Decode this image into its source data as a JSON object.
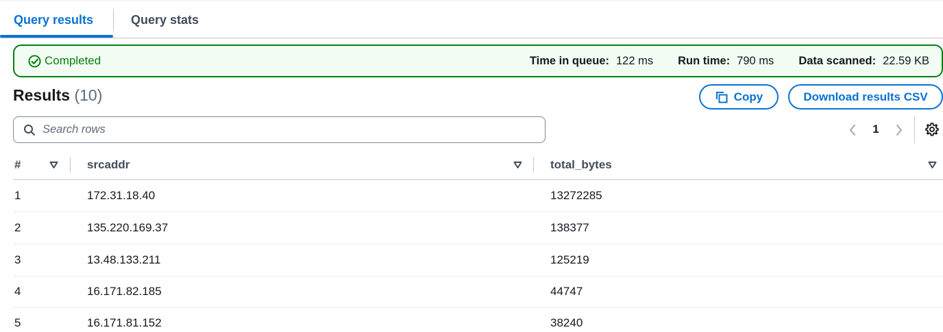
{
  "tabs": [
    {
      "label": "Query results",
      "active": true
    },
    {
      "label": "Query stats",
      "active": false
    }
  ],
  "status": {
    "text": "Completed",
    "color": "#037f0c",
    "icon": "check-circle-icon",
    "stats": [
      {
        "label": "Time in queue:",
        "value": "122 ms"
      },
      {
        "label": "Run time:",
        "value": "790 ms"
      },
      {
        "label": "Data scanned:",
        "value": "22.59 KB"
      }
    ]
  },
  "results": {
    "title": "Results",
    "count": "(10)",
    "copy_label": "Copy",
    "download_label": "Download results CSV"
  },
  "search": {
    "placeholder": "Search rows",
    "value": ""
  },
  "pagination": {
    "current_page": "1"
  },
  "table": {
    "columns": [
      "#",
      "srcaddr",
      "total_bytes"
    ],
    "rows": [
      [
        "1",
        "172.31.18.40",
        "13272285"
      ],
      [
        "2",
        "135.220.169.37",
        "138377"
      ],
      [
        "3",
        "13.48.133.211",
        "125219"
      ],
      [
        "4",
        "16.171.82.185",
        "44747"
      ],
      [
        "5",
        "16.171.81.152",
        "38240"
      ]
    ]
  },
  "colors": {
    "accent": "#0972d3",
    "success": "#037f0c",
    "success_bg": "#f2fcf3"
  }
}
